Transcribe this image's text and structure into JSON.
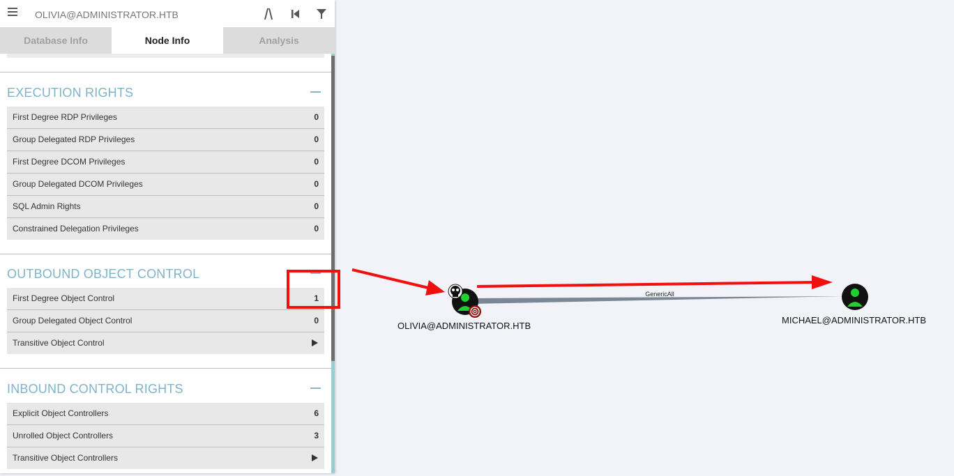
{
  "header": {
    "search_value": "OLIVIA@ADMINISTRATOR.HTB",
    "icons": [
      "menu-icon",
      "pathfinding-icon",
      "back-icon",
      "filter-icon"
    ]
  },
  "tabs": [
    {
      "label": "Database Info",
      "active": false
    },
    {
      "label": "Node Info",
      "active": true
    },
    {
      "label": "Analysis",
      "active": false
    }
  ],
  "sections": {
    "execution": {
      "title": "EXECUTION RIGHTS",
      "rows": [
        {
          "label": "First Degree RDP Privileges",
          "value": "0"
        },
        {
          "label": "Group Delegated RDP Privileges",
          "value": "0"
        },
        {
          "label": "First Degree DCOM Privileges",
          "value": "0"
        },
        {
          "label": "Group Delegated DCOM Privileges",
          "value": "0"
        },
        {
          "label": "SQL Admin Rights",
          "value": "0"
        },
        {
          "label": "Constrained Delegation Privileges",
          "value": "0"
        }
      ]
    },
    "outbound": {
      "title": "OUTBOUND OBJECT CONTROL",
      "rows": [
        {
          "label": "First Degree Object Control",
          "value": "1"
        },
        {
          "label": "Group Delegated Object Control",
          "value": "0"
        },
        {
          "label": "Transitive Object Control",
          "value": "▶"
        }
      ]
    },
    "inbound": {
      "title": "INBOUND CONTROL RIGHTS",
      "rows": [
        {
          "label": "Explicit Object Controllers",
          "value": "6"
        },
        {
          "label": "Unrolled Object Controllers",
          "value": "3"
        },
        {
          "label": "Transitive Object Controllers",
          "value": "▶"
        }
      ]
    }
  },
  "graph": {
    "nodes": [
      {
        "label": "OLIVIA@ADMINISTRATOR.HTB",
        "badges": [
          "skull-icon",
          "target-icon"
        ]
      },
      {
        "label": "MICHAEL@ADMINISTRATOR.HTB",
        "badges": []
      }
    ],
    "edge_label": "GenericAll"
  },
  "colors": {
    "accent_title": "#7fb3c8",
    "annotation_red": "#f20f0f",
    "node_green": "#1fd12f",
    "edge_gray": "#7b8794"
  }
}
